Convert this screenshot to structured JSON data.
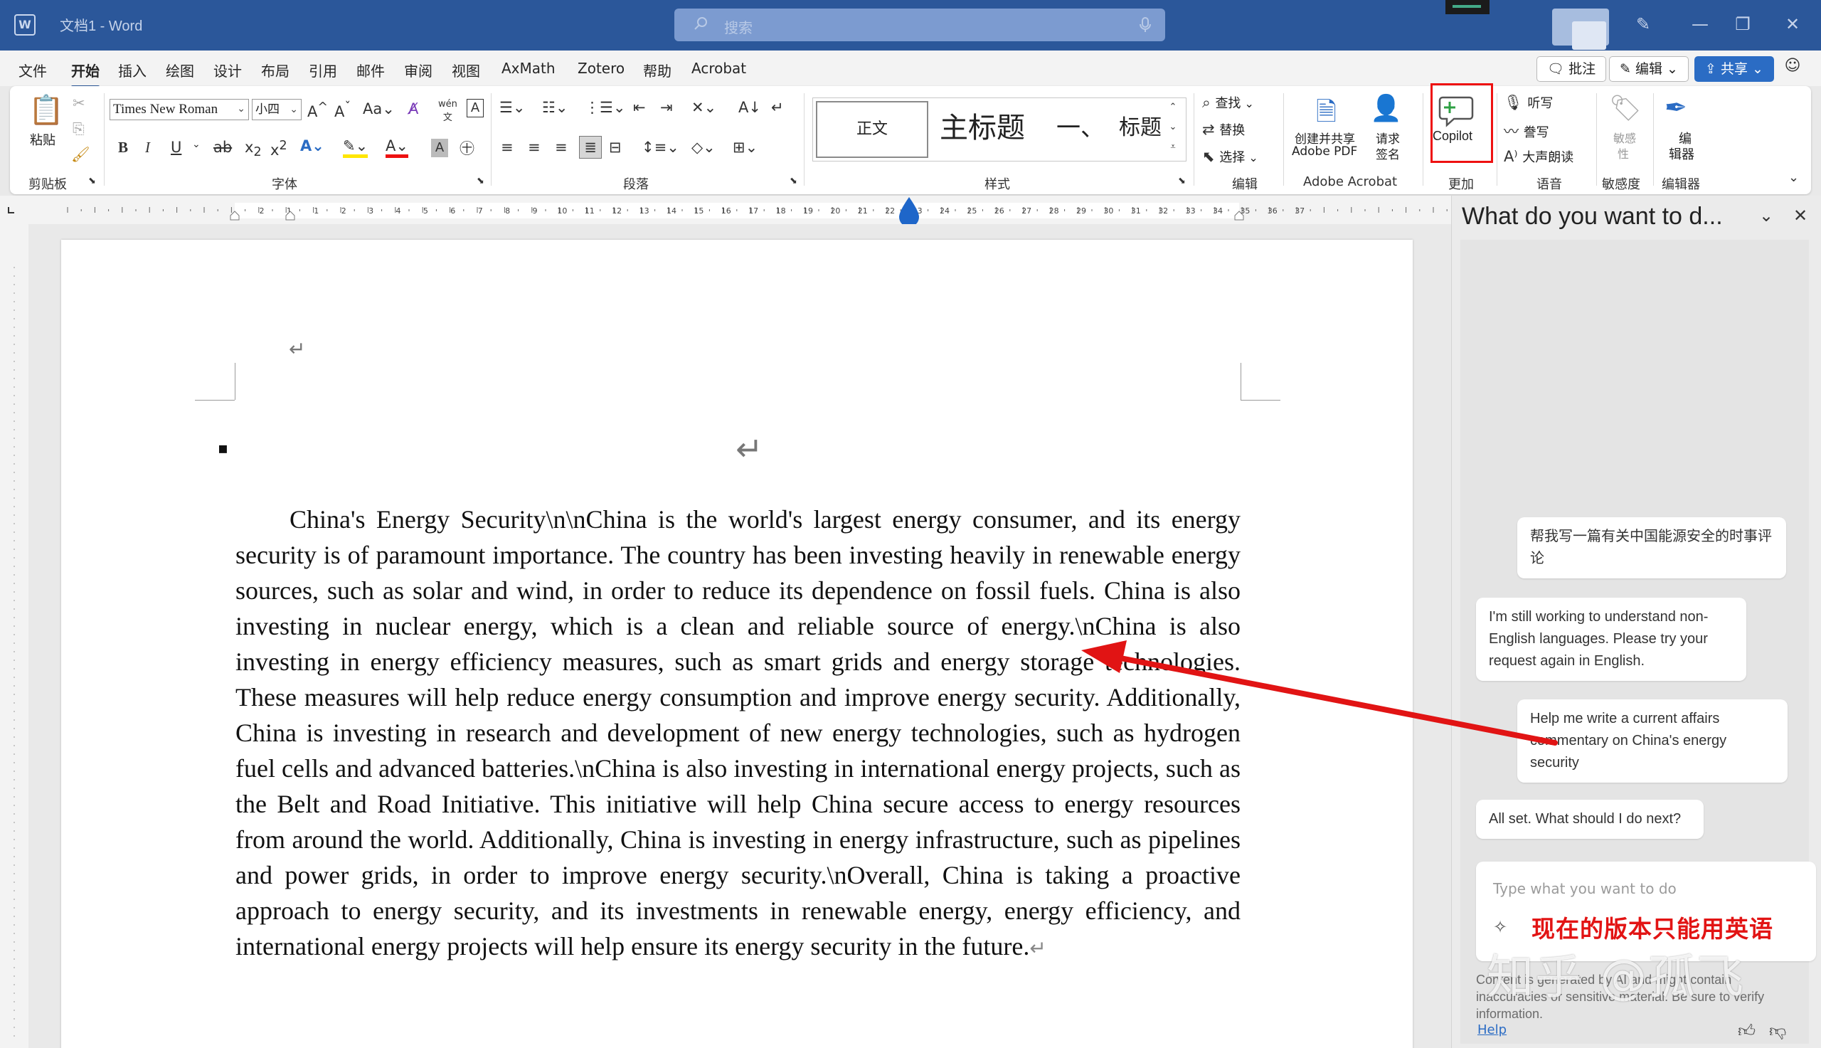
{
  "titlebar": {
    "doc_title": "文档1  -  Word",
    "search_placeholder": "搜索"
  },
  "menu": {
    "tabs": [
      "文件",
      "开始",
      "插入",
      "绘图",
      "设计",
      "布局",
      "引用",
      "邮件",
      "审阅",
      "视图",
      "AxMath",
      "Zotero",
      "帮助",
      "Acrobat"
    ],
    "active": "开始",
    "comments_label": "批注",
    "editing_label": "编辑",
    "share_label": "共享"
  },
  "ribbon": {
    "clipboard": {
      "paste": "粘贴",
      "group": "剪贴板"
    },
    "font": {
      "font_name": "Times New Roman",
      "font_size": "小四",
      "group": "字体"
    },
    "paragraph": {
      "group": "段落"
    },
    "styles": {
      "normal": "正文",
      "title": "主标题",
      "heading1": "一、",
      "heading": "标题",
      "group": "样式"
    },
    "editing": {
      "find": "查找",
      "replace": "替换",
      "select": "选择",
      "group": "编辑"
    },
    "acrobat": {
      "create_share": "创建并共享",
      "adobe_pdf": "Adobe PDF",
      "request": "请求",
      "sign": "签名",
      "group": "Adobe Acrobat"
    },
    "more": {
      "copilot": "Copilot",
      "group": "更加"
    },
    "voice": {
      "dictate": "听写",
      "transcribe": "誊写",
      "read_aloud": "大声朗读",
      "group": "语音"
    },
    "sensitivity": {
      "label1": "敏感",
      "label2": "性",
      "group": "敏感度"
    },
    "editor": {
      "label1": "编",
      "label2": "辑器",
      "group": "编辑器"
    }
  },
  "ruler_numbers": [
    "2",
    "1",
    "1",
    "2",
    "3",
    "4",
    "5",
    "6",
    "7",
    "8",
    "9",
    "10",
    "11",
    "12",
    "13",
    "14",
    "15",
    "16",
    "17",
    "18",
    "19",
    "20",
    "21",
    "22",
    "23",
    "24",
    "25",
    "26",
    "27",
    "28",
    "29",
    "30",
    "31",
    "32",
    "33",
    "34",
    "35",
    "36",
    "37"
  ],
  "document": {
    "body": "China's Energy Security\\n\\nChina is the world's largest energy consumer, and its energy security is of paramount importance. The country has been investing heavily in renewable energy sources, such as solar and wind, in order to reduce its dependence on fossil fuels. China is also investing in nuclear energy, which is a clean and reliable source of energy.\\nChina is also investing in energy efficiency measures, such as smart grids and energy storage technologies. These measures will help reduce energy consumption and improve energy security. Additionally, China is investing in research and development of new energy technologies, such as hydrogen fuel cells and advanced batteries.\\nChina is also investing in international energy projects, such as the Belt and Road Initiative. This initiative will help China secure access to energy resources from around the world. Additionally, China is investing in energy infrastructure, such as pipelines and power grids, in order to improve energy security.\\nOverall, China is taking a proactive approach to energy security, and its investments in renewable energy, energy efficiency, and international energy projects will help ensure its energy security in the future.",
    "return_glyph": "↵",
    "bullet": "▪"
  },
  "pane": {
    "title": "What do you want to d...",
    "messages": [
      {
        "role": "user",
        "text": "帮我写一篇有关中国能源安全的时事评论"
      },
      {
        "role": "assistant",
        "text": "I'm still working to understand non-English languages. Please try your request again in English."
      },
      {
        "role": "user",
        "text": "Help me write a current affairs commentary on China's energy security"
      },
      {
        "role": "assistant",
        "text": "All set. What should I do next?"
      }
    ],
    "input_placeholder": "Type what you want to do",
    "annotation": "现在的版本只能用英语",
    "disclaimer": "Content is generated by AI and might contain inaccuracies or sensitive material. Be sure to verify information.",
    "help": "Help"
  },
  "watermark": "知乎 @孤飞",
  "colors": {
    "titlebar": "#2b579a",
    "accent": "#2b6cc4",
    "annotation_red": "#e21414"
  }
}
